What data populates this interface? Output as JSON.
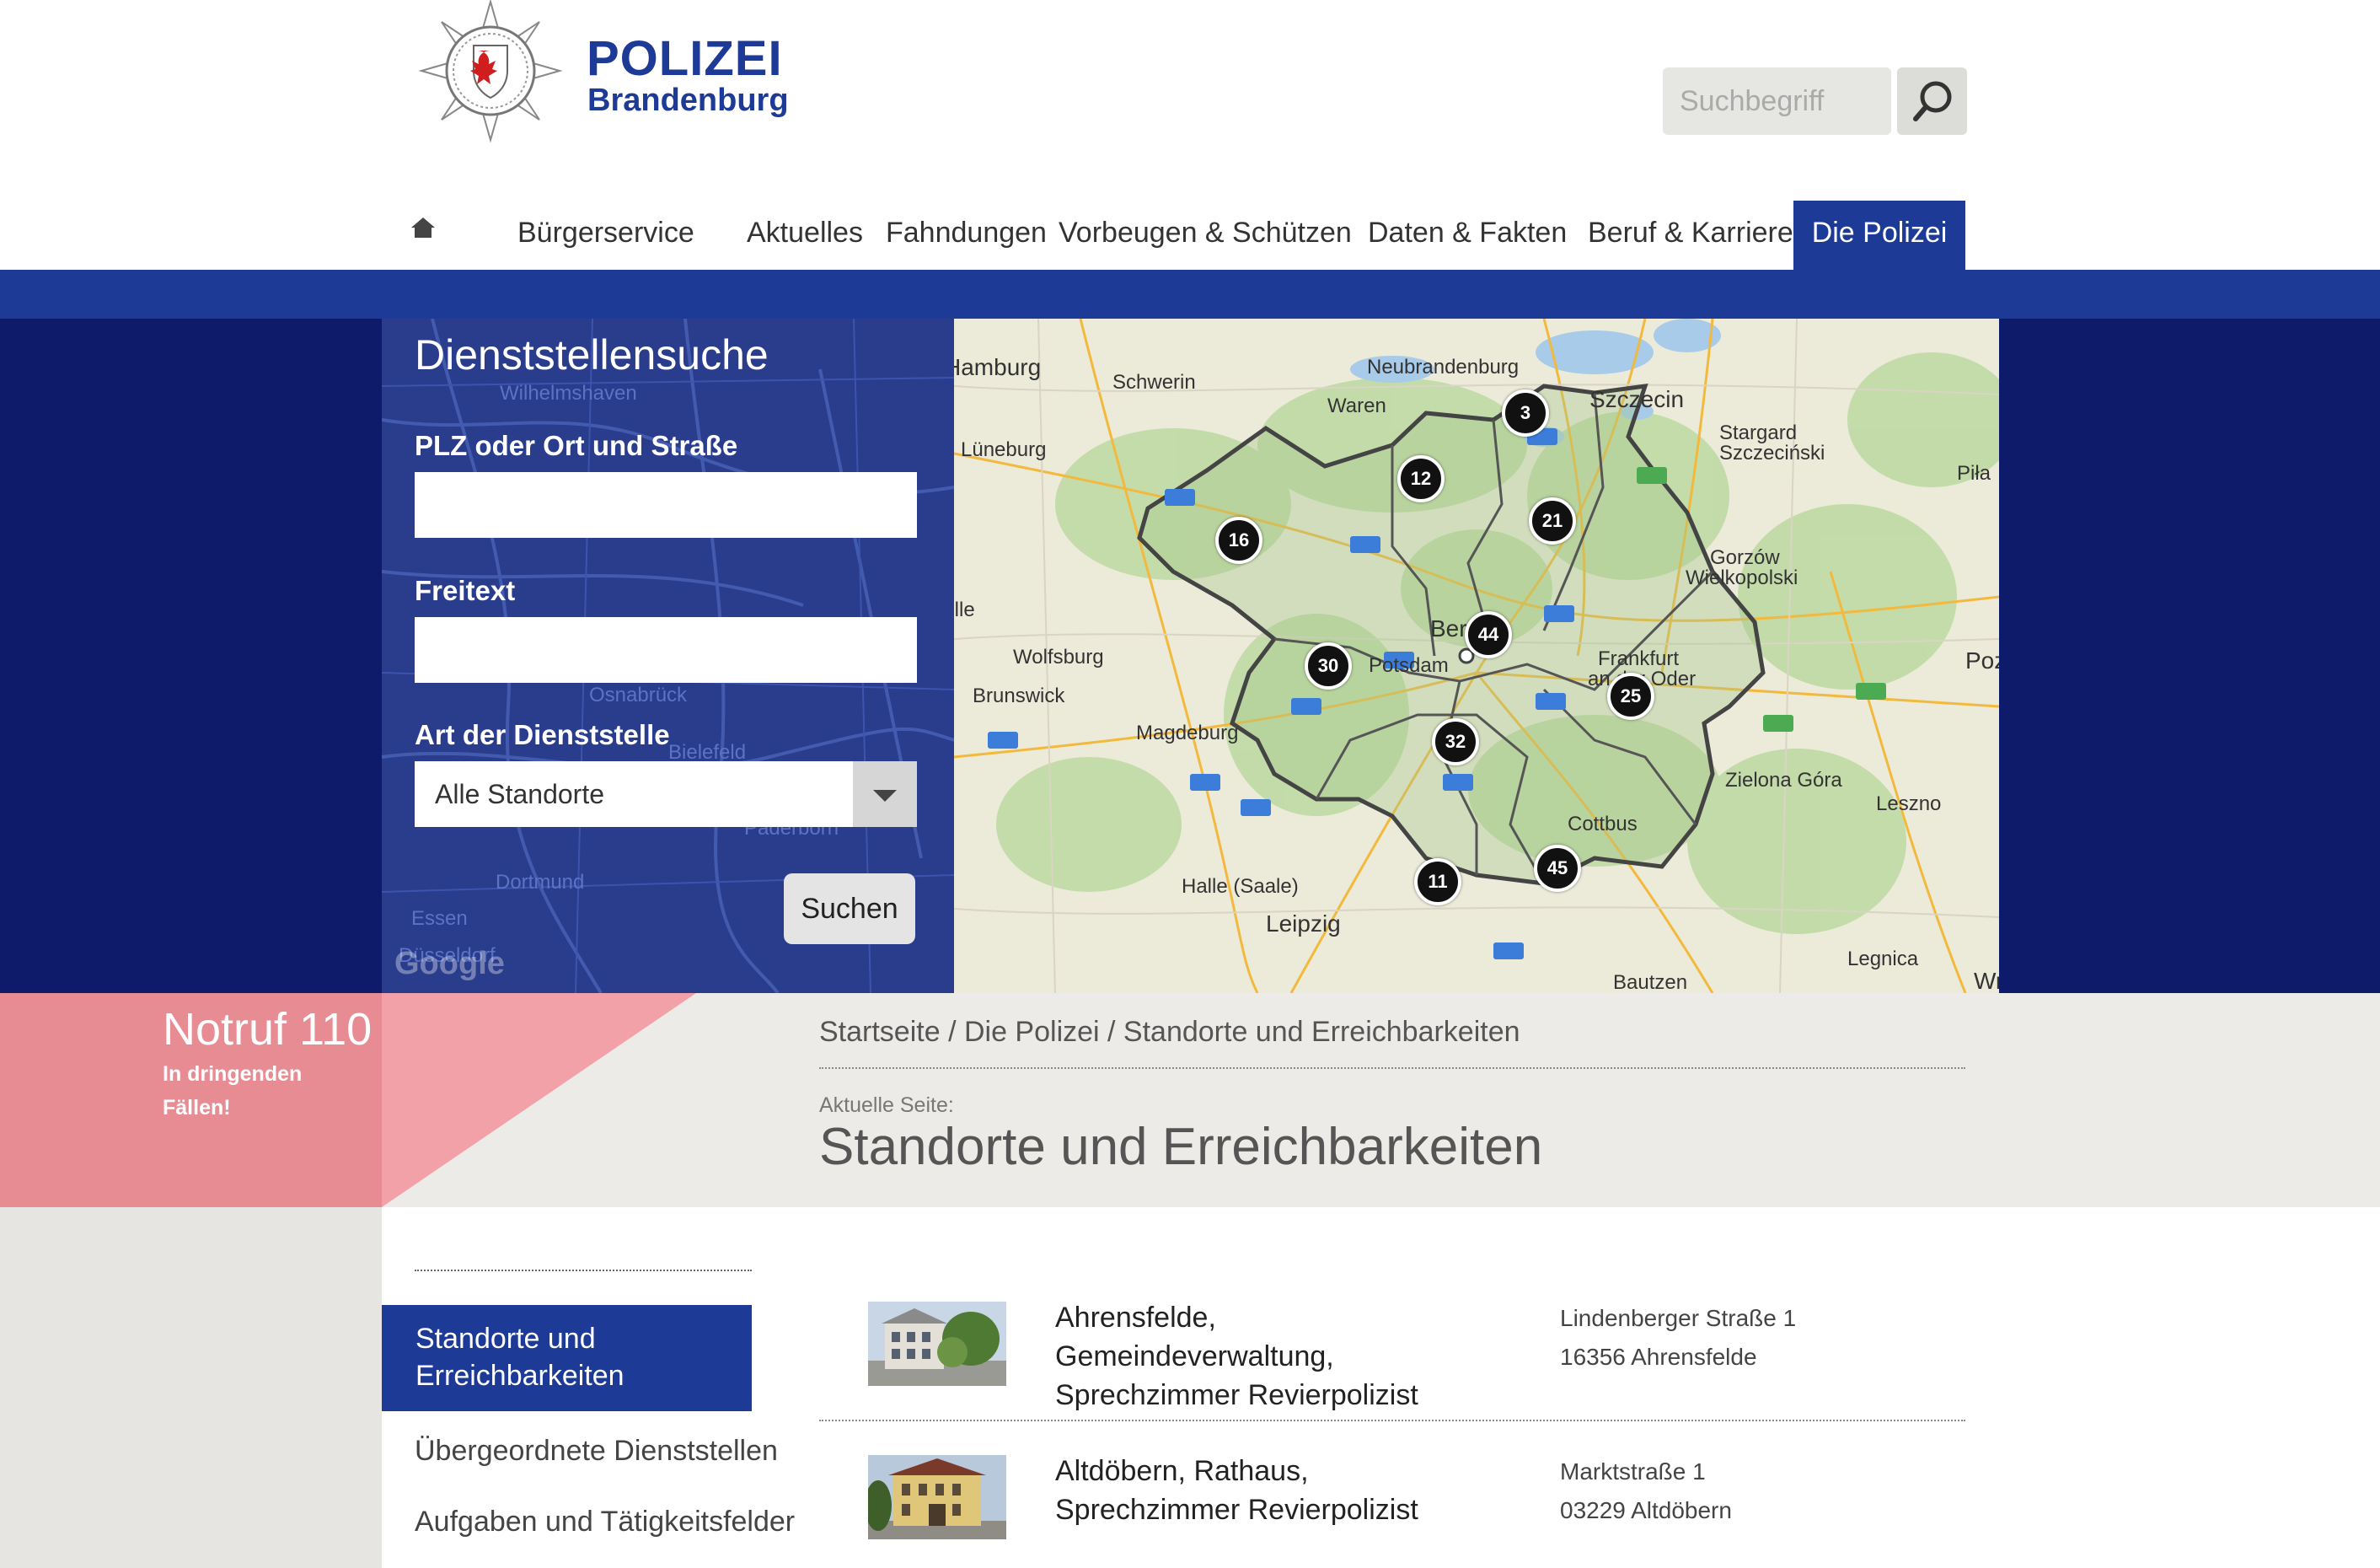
{
  "header": {
    "brand_line1": "POLIZEI",
    "brand_line2": "Brandenburg",
    "search_placeholder": "Suchbegriff"
  },
  "nav": {
    "items": [
      {
        "label": "Bürgerservice"
      },
      {
        "label": "Aktuelles"
      },
      {
        "label": "Fahndungen"
      },
      {
        "label": "Vorbeugen & Schützen"
      },
      {
        "label": "Daten & Fakten"
      },
      {
        "label": "Beruf & Karriere"
      },
      {
        "label": "Die Polizei",
        "active": true
      }
    ]
  },
  "search_panel": {
    "title": "Dienststellensuche",
    "field1_label": "PLZ oder Ort und Straße",
    "field2_label": "Freitext",
    "type_label": "Art der Dienststelle",
    "type_value": "Alle Standorte",
    "submit_label": "Suchen",
    "google": "Google"
  },
  "map": {
    "labels": [
      {
        "text": "Hamburg",
        "big": true
      },
      {
        "text": "Schwerin"
      },
      {
        "text": "Neubrandenburg"
      },
      {
        "text": "Waren"
      },
      {
        "text": "Szczecin",
        "big": true
      },
      {
        "text": "Stargard"
      },
      {
        "text": "Szczeciński"
      },
      {
        "text": "Piła"
      },
      {
        "text": "Lüneburg"
      },
      {
        "text": "Gorzów"
      },
      {
        "text": "Wielkopolski"
      },
      {
        "text": "Celle"
      },
      {
        "text": "Wolfsburg"
      },
      {
        "text": "Brunswick"
      },
      {
        "text": "Potsdam"
      },
      {
        "text": "Frankfurt"
      },
      {
        "text": "an der Oder"
      },
      {
        "text": "Poz"
      },
      {
        "text": "Magdeburg"
      },
      {
        "text": "Zielona Góra"
      },
      {
        "text": "Leszno"
      },
      {
        "text": "Cottbus"
      },
      {
        "text": "Halle (Saale)"
      },
      {
        "text": "Leipzig",
        "big": true
      },
      {
        "text": "Legnica"
      },
      {
        "text": "Bautzen"
      },
      {
        "text": "Wilhelmshaven"
      },
      {
        "text": "Osnabrück"
      },
      {
        "text": "Bielefeld"
      },
      {
        "text": "Paderborn"
      },
      {
        "text": "Dortmund"
      },
      {
        "text": "Essen"
      },
      {
        "text": "Düsseldorf"
      },
      {
        "text": "Ber"
      },
      {
        "text": "Wr"
      }
    ],
    "clusters": [
      {
        "count": "3"
      },
      {
        "count": "12"
      },
      {
        "count": "21"
      },
      {
        "count": "16"
      },
      {
        "count": "44"
      },
      {
        "count": "30"
      },
      {
        "count": "25"
      },
      {
        "count": "32"
      },
      {
        "count": "45"
      },
      {
        "count": "11"
      }
    ]
  },
  "emergency": {
    "title": "Notruf 110",
    "subtitle": "In dringenden Fällen!"
  },
  "breadcrumb": "Startseite / Die Polizei / Standorte und Erreichbarkeiten",
  "current_page_label": "Aktuelle Seite:",
  "page_title": "Standorte und Erreichbarkeiten",
  "sidebar": {
    "active": "Standorte und Erreichbarkeiten",
    "links": [
      {
        "label": "Übergeordnete Dienststellen"
      },
      {
        "label": "Aufgaben und Tätigkeitsfelder"
      }
    ]
  },
  "locations": [
    {
      "name": "Ahrensfelde, Gemeindeverwaltung, Sprechzimmer Revierpolizist",
      "street": "Lindenberger Straße 1",
      "city": "16356 Ahrensfelde"
    },
    {
      "name": "Altdöbern, Rathaus, Sprechzimmer Revierpolizist",
      "street": "Marktstraße 1",
      "city": "03229 Altdöbern"
    }
  ],
  "colors": {
    "primary_blue": "#1c3a96",
    "dark_navy": "#0e1b6a",
    "emergency_pink": "#e88c94"
  }
}
